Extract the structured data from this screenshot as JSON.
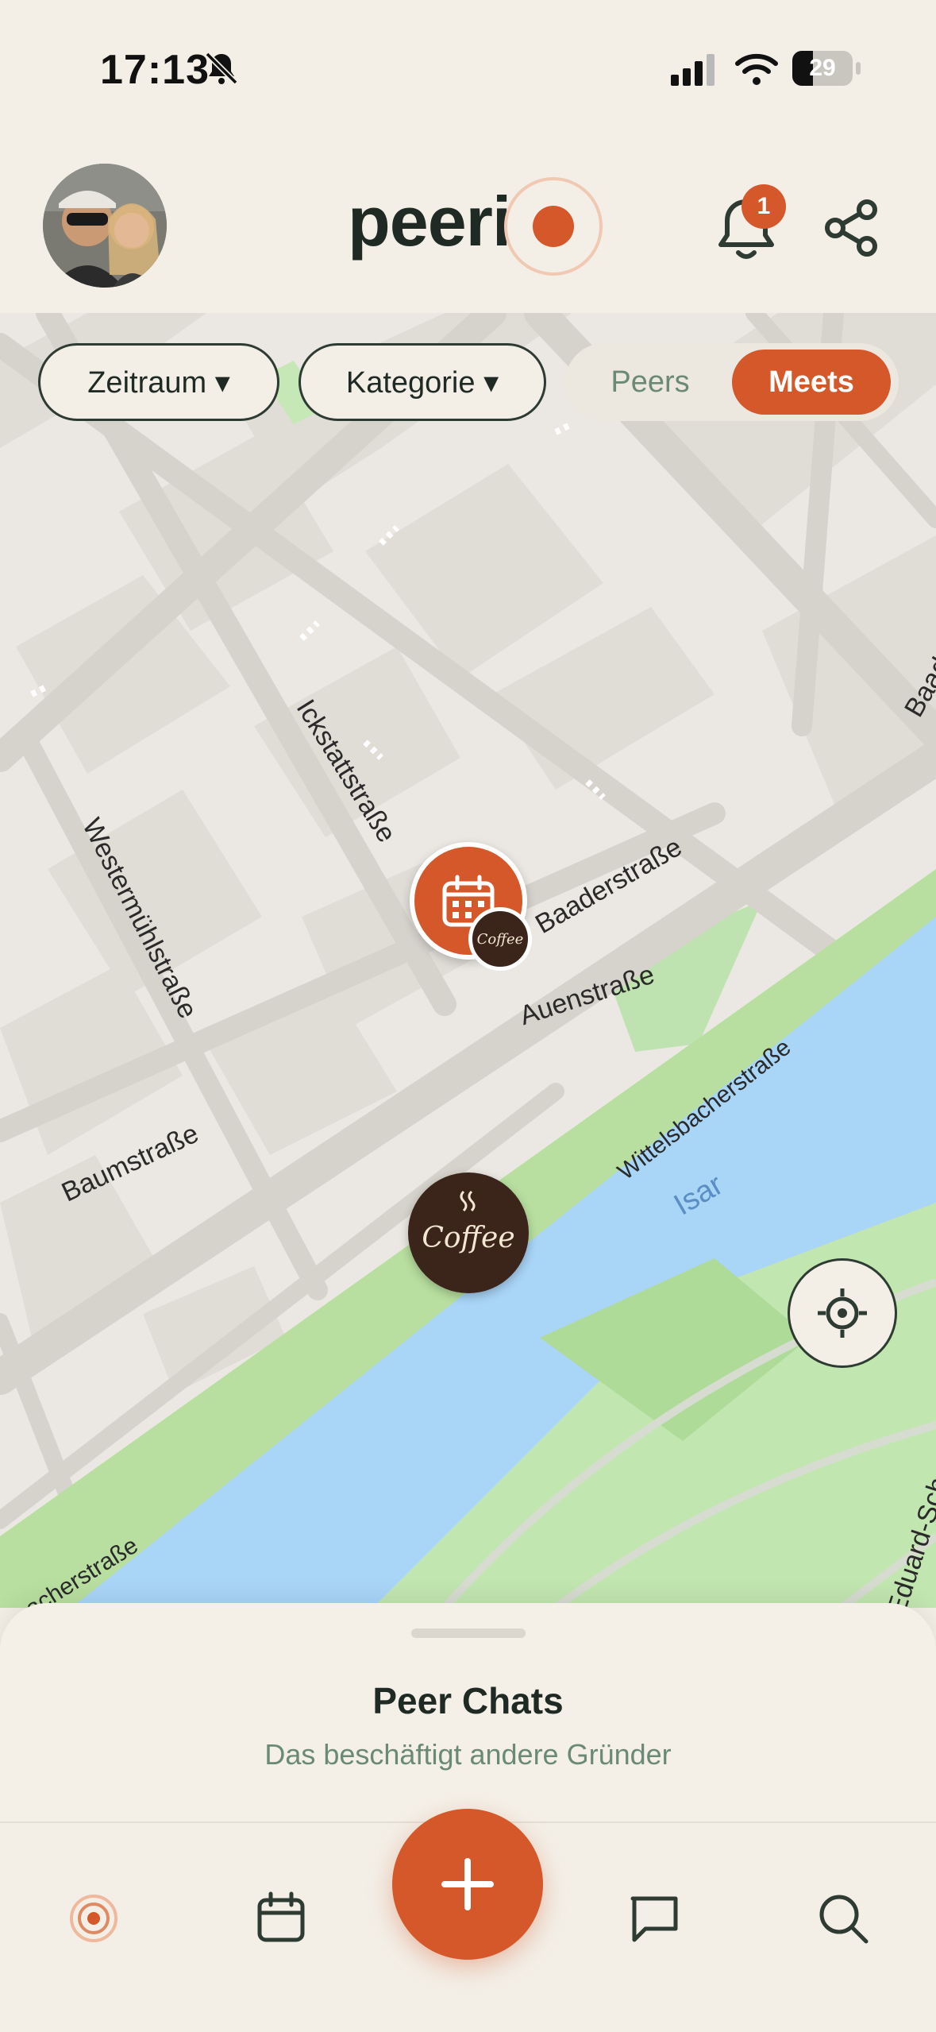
{
  "status_bar": {
    "time": "17:13",
    "battery": "29"
  },
  "header": {
    "logo": "peeri",
    "notification_count": "1"
  },
  "filters": {
    "period": "Zeitraum ▾",
    "category": "Kategorie ▾"
  },
  "toggle": {
    "peers": "Peers",
    "meets": "Meets",
    "active": "Meets"
  },
  "map": {
    "streets": [
      "Ickstattstraße",
      "Baaderstraße",
      "Auenstraße",
      "Westermühlstraße",
      "Baumstraße",
      "Wittelsbacherstraße",
      "Isar",
      "Baad",
      "Eduard-Sch",
      "lsbacherstraße"
    ],
    "coffee_label": "Coffee"
  },
  "sheet": {
    "title": "Peer Chats",
    "subtitle": "Das beschäftigt andere Gründer"
  },
  "colors": {
    "accent": "#d4582a",
    "dark": "#1f2a24",
    "water": "#a9d5f7",
    "park": "#bfe3b0"
  }
}
